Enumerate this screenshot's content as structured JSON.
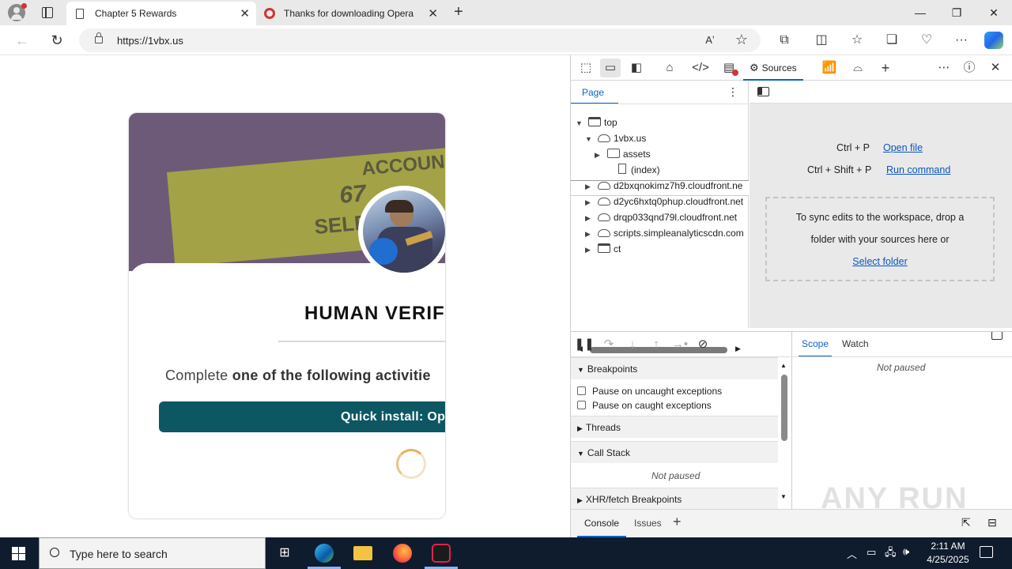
{
  "browser": {
    "tabs": [
      {
        "title": "Chapter 5 Rewards",
        "active": true
      },
      {
        "title": "Thanks for downloading Opera",
        "active": false
      }
    ],
    "url": "https://1vbx.us"
  },
  "page": {
    "banner_lines": [
      "ACCOUN",
      "67",
      "SELEC"
    ],
    "verify_title": "HUMAN VERIFI",
    "complete_prefix": "Complete ",
    "complete_bold": "one of the following activitie",
    "quick_install_label": "Quick install: Op"
  },
  "devtools": {
    "active_tab": "Sources",
    "nav_tab": "Page",
    "tree": [
      {
        "label": "top",
        "indent": 0,
        "icon": "window",
        "expanded": true
      },
      {
        "label": "1vbx.us",
        "indent": 1,
        "icon": "cloud",
        "expanded": true
      },
      {
        "label": "assets",
        "indent": 2,
        "icon": "folder",
        "expanded": false
      },
      {
        "label": "(index)",
        "indent": 3,
        "icon": "file",
        "selected": true
      },
      {
        "label": "d2bxqnokimz7h9.cloudfront.ne",
        "indent": 1,
        "icon": "cloud",
        "expanded": false
      },
      {
        "label": "d2yc6hxtq0phup.cloudfront.net",
        "indent": 1,
        "icon": "cloud",
        "expanded": false
      },
      {
        "label": "drqp033qnd79l.cloudfront.net",
        "indent": 1,
        "icon": "cloud",
        "expanded": false
      },
      {
        "label": "scripts.simpleanalyticscdn.com",
        "indent": 1,
        "icon": "cloud",
        "expanded": false
      },
      {
        "label": "ct",
        "indent": 1,
        "icon": "window",
        "expanded": false
      }
    ],
    "shortcuts": [
      {
        "keys": "Ctrl + P",
        "action": "Open file"
      },
      {
        "keys": "Ctrl + Shift + P",
        "action": "Run command"
      }
    ],
    "drop_text_1": "To sync edits to the workspace, drop a",
    "drop_text_2": "folder with your sources here or",
    "drop_link": "Select folder",
    "breakpoints_label": "Breakpoints",
    "pause_uncaught": "Pause on uncaught exceptions",
    "pause_caught": "Pause on caught exceptions",
    "threads_label": "Threads",
    "call_stack_label": "Call Stack",
    "not_paused": "Not paused",
    "xhr_label": "XHR/fetch Breakpoints",
    "scope_tab": "Scope",
    "watch_tab": "Watch",
    "console_tab": "Console",
    "issues_tab": "Issues"
  },
  "watermark": "ANY RUN",
  "taskbar": {
    "search_placeholder": "Type here to search",
    "time": "2:11 AM",
    "date": "4/25/2025"
  }
}
